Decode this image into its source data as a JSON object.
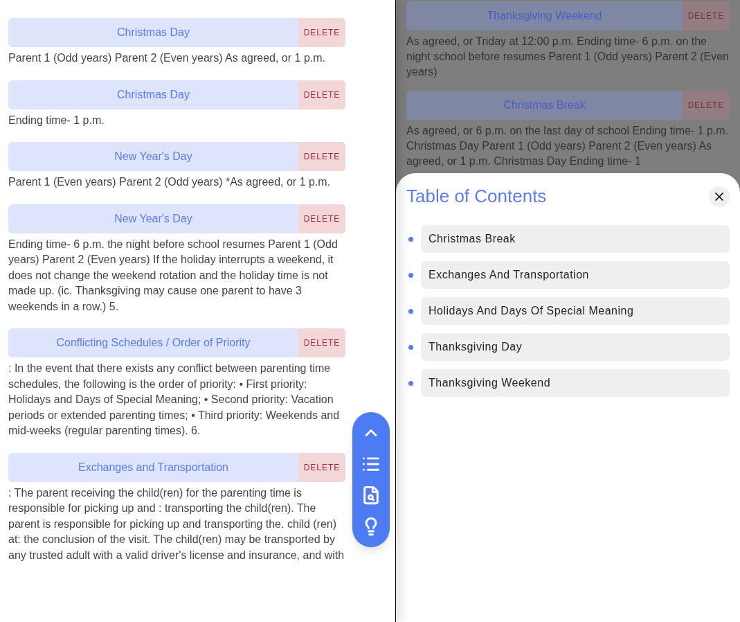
{
  "sections": [
    {
      "title": "Christmas Day",
      "action": "DELETE",
      "body": "Parent 1 (Odd years) Parent 2 (Even years) As agreed, or 1 p.m."
    },
    {
      "title": "Christmas Day",
      "action": "DELETE",
      "body": "Ending time- 1 p.m."
    },
    {
      "title": "New Year's Day",
      "action": "DELETE",
      "body": "Parent 1 (Even years) Parent 2 (Odd years) *As agreed, or 1 p.m."
    },
    {
      "title": "New Year's Day",
      "action": "DELETE",
      "body": "Ending time- 6 p.m. the night before school resumes Parent 1 (Odd years) Parent 2 (Even years) If the holiday interrupts a weekend, it does not change the weekend rotation and the holiday time is not made up. (ic. Thanksgiving may cause one parent to have 3 weekends in a row.) 5."
    },
    {
      "title": "Conflicting Schedules / Order of Priority",
      "action": "DELETE",
      "body": ": In the event that there exists any conflict between parenting time schedules, the following is the order of priority: • First priority: Holidays and Days of Special Meaning; • Second priority: Vacation periods or extended parenting times; • Third priority: Weekends and mid-weeks (regular parenting times). 6."
    },
    {
      "title": "Exchanges and Transportation",
      "action": "DELETE",
      "body": ": The parent receiving the child(ren) for the parenting time is responsible for picking up and : transporting the child(ren). The parent is responsible for picking up and transporting the. child (ren) at: the conclusion of the visit. The child(ren) may be transported by any trusted adult with a valid driver's license and insurance, and with"
    }
  ],
  "background_sections": [
    {
      "title": "Thanksgiving Weekend",
      "action": "DELETE",
      "body": "As agreed, or Triday at 12:00 p.m. Ending time- 6 p.m. on the night school before resumes Parent 1 (Odd years) Parent 2 (Even years)"
    },
    {
      "title": "Christmas Break",
      "action": "DELETE",
      "body": "As agreed, or 6 p.m. on the last day of school Ending time- 1 p.m. Christmas Day Parent 1 (Odd years) Parent 2 (Even years) As agreed, or 1 p.m. Christmas Day Ending time- 1"
    }
  ],
  "toc": {
    "title": "Table of Contents",
    "items": [
      {
        "label": "Christmas Break"
      },
      {
        "label": "Exchanges And Transportation"
      },
      {
        "label": "Holidays And Days Of Special Meaning"
      },
      {
        "label": "Thanksgiving Day"
      },
      {
        "label": "Thanksgiving Weekend"
      }
    ]
  }
}
